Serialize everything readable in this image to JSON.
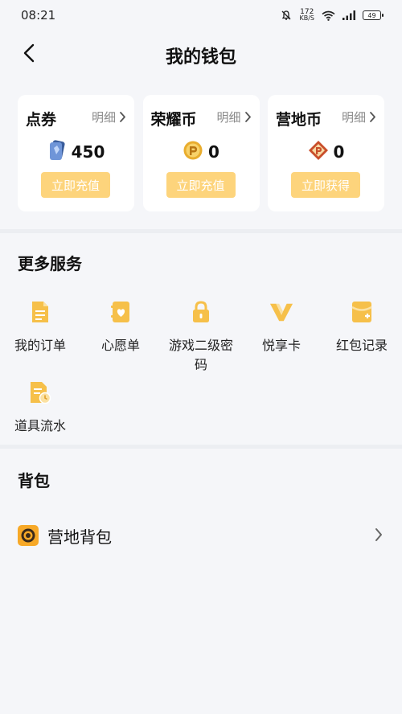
{
  "status_bar": {
    "time": "08:21",
    "net_speed_value": "172",
    "net_speed_unit": "KB/S",
    "battery": "49",
    "icons": [
      "bell-off-icon",
      "wifi-icon",
      "signal-icon",
      "battery-icon"
    ]
  },
  "header": {
    "title": "我的钱包",
    "back_icon": "chevron-left-icon"
  },
  "wallet": {
    "cards": [
      {
        "title": "点券",
        "detail": "明细",
        "value": "450",
        "button": "立即充值",
        "icon": "voucher-card-icon",
        "icon_color": "#4a6fb5"
      },
      {
        "title": "荣耀币",
        "detail": "明细",
        "value": "0",
        "button": "立即充值",
        "icon": "honor-coin-icon",
        "icon_color": "#e0a52a"
      },
      {
        "title": "营地币",
        "detail": "明细",
        "value": "0",
        "button": "立即获得",
        "icon": "camp-coin-icon",
        "icon_color": "#d0542e"
      }
    ],
    "button_color": "#fdd47c"
  },
  "services": {
    "title": "更多服务",
    "accent_color": "#f6c04a",
    "items": [
      {
        "label": "我的订单",
        "icon": "order-document-icon"
      },
      {
        "label": "心愿单",
        "icon": "wishlist-heart-icon"
      },
      {
        "label": "游戏二级密码",
        "icon": "lock-icon"
      },
      {
        "label": "悦享卡",
        "icon": "v-card-icon"
      },
      {
        "label": "红包记录",
        "icon": "red-packet-record-icon"
      },
      {
        "label": "道具流水",
        "icon": "item-history-icon"
      }
    ]
  },
  "bag": {
    "title": "背包",
    "item_label": "营地背包",
    "item_icon": "camp-bag-icon",
    "arrow_icon": "chevron-right-icon"
  }
}
